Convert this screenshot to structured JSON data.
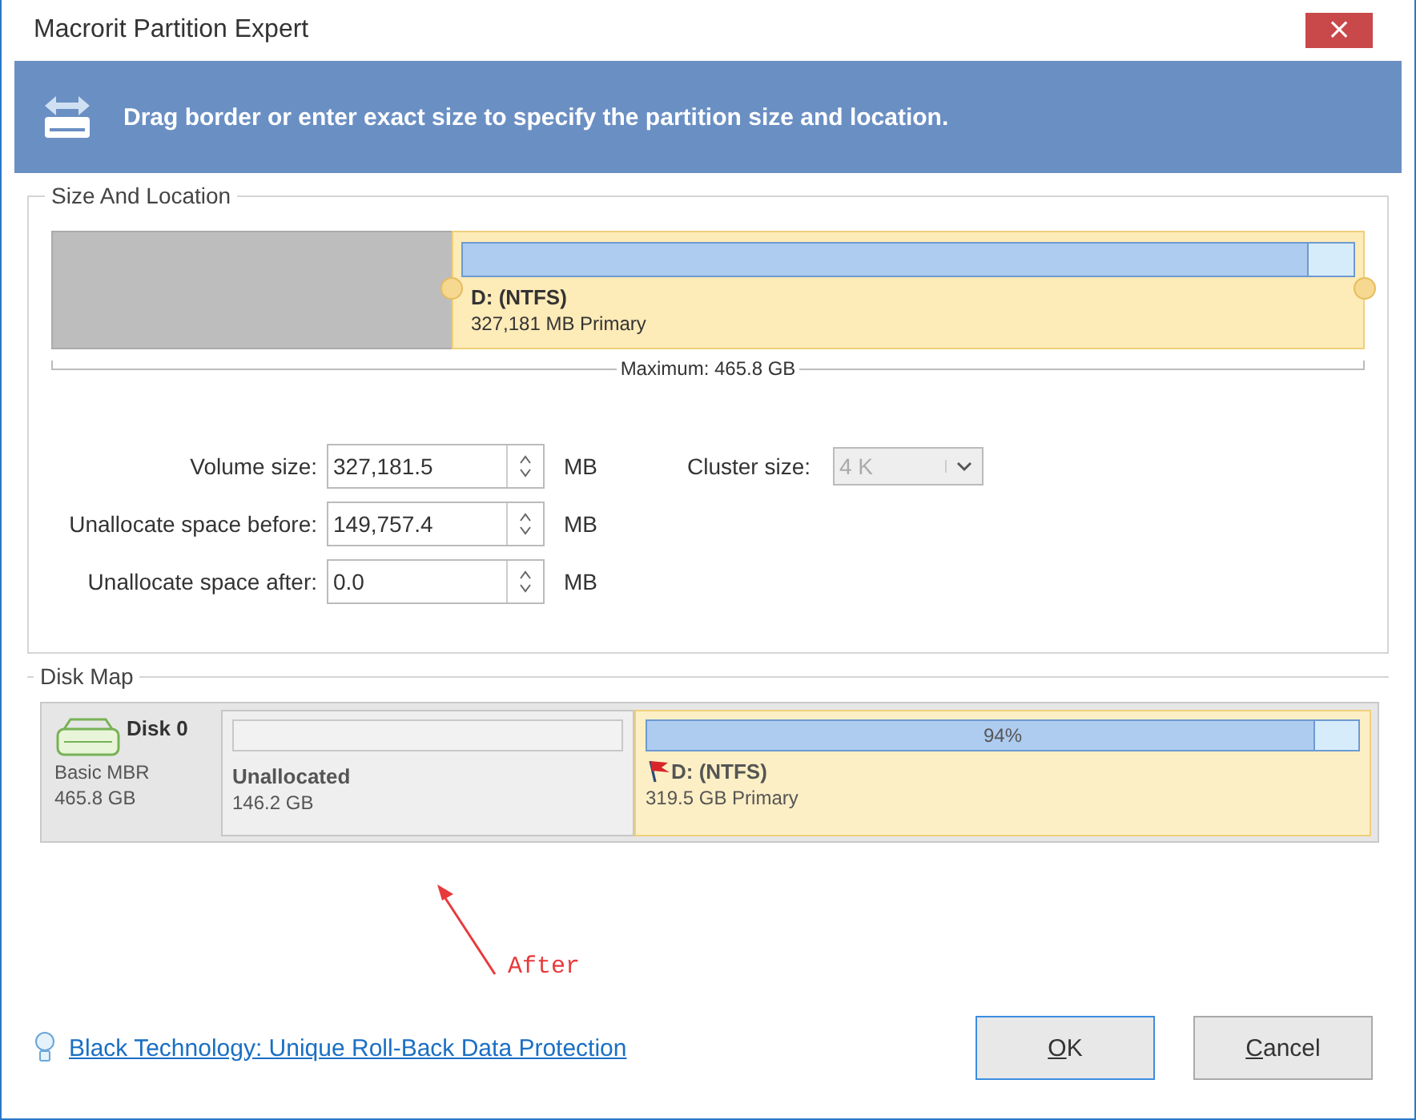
{
  "window": {
    "title": "Macrorit Partition Expert",
    "close": "×"
  },
  "banner": {
    "text": "Drag border or enter exact size to specify the partition size and location."
  },
  "size_and_location": {
    "title": "Size And Location",
    "partition": {
      "name": "D: (NTFS)",
      "detail": "327,181 MB Primary",
      "usage": {
        "level": 0.95
      }
    },
    "maximum": "Maximum: 465.8 GB",
    "fields": [
      {
        "label": "Volume size:",
        "value": "327,181.5",
        "unit": "MB"
      },
      {
        "label": "Unallocate space before:",
        "value": "149,757.4",
        "unit": "MB"
      },
      {
        "label": "Unallocate space after:",
        "value": "0.0",
        "unit": "MB"
      }
    ],
    "cluster": {
      "label": "Cluster size:",
      "value": "4 K",
      "disabled": true
    }
  },
  "disk_map": {
    "title": "Disk Map",
    "disk": {
      "name": "Disk 0",
      "type": "Basic MBR",
      "size": "465.8 GB"
    },
    "partitions": [
      {
        "kind": "unallocated",
        "name": "Unallocated",
        "detail": "146.2 GB"
      },
      {
        "kind": "ntfs",
        "name": "D: (NTFS)",
        "detail": "319.5 GB Primary",
        "usage": {
          "level": 0.94,
          "reading": "94%"
        }
      }
    ]
  },
  "annotation": {
    "text": "After"
  },
  "footer": {
    "link": "Black Technology: Unique Roll-Back Data Protection",
    "buttons": [
      {
        "label": "OK",
        "focused": true,
        "mnemonic_underlined": true
      },
      {
        "label": "Cancel",
        "focused": false,
        "mnemonic_underlined": true
      }
    ]
  }
}
